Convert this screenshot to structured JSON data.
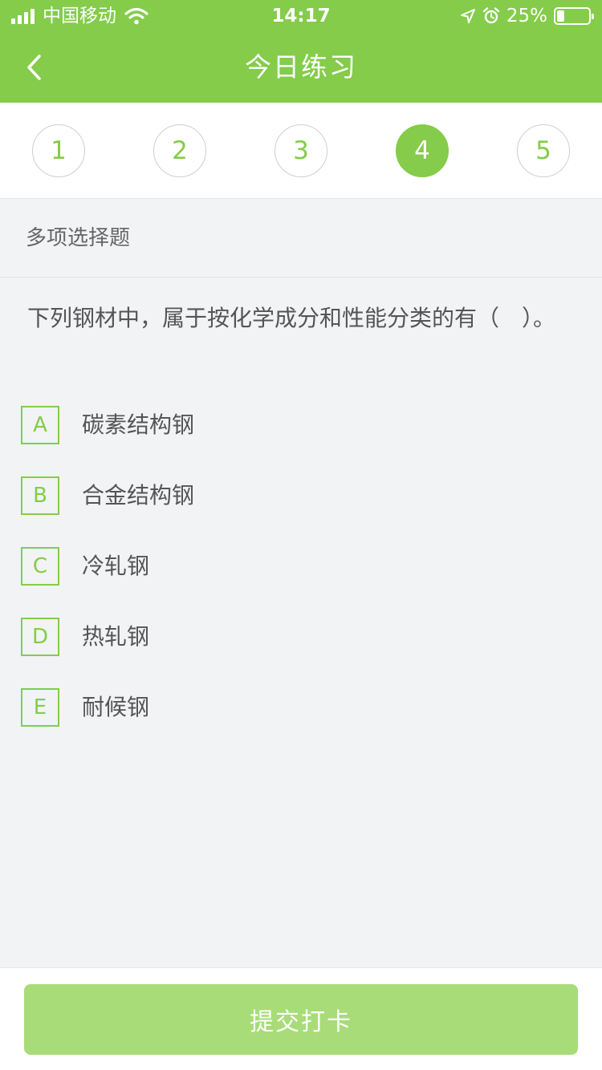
{
  "status_bar": {
    "carrier": "中国移动",
    "time": "14:17",
    "battery_percent": "25%",
    "battery_level": 0.25,
    "icons": [
      "signal-icon",
      "wifi-icon",
      "location-arrow-icon",
      "alarm-icon",
      "battery-icon"
    ]
  },
  "nav": {
    "title": "今日练习",
    "back_icon": "chevron-left-icon"
  },
  "question_numbers": {
    "items": [
      "1",
      "2",
      "3",
      "4",
      "5"
    ],
    "active": "4"
  },
  "question": {
    "type_label": "多项选择题",
    "text": "下列钢材中，属于按化学成分和性能分类的有（　）。",
    "options": [
      {
        "letter": "A",
        "text": "碳素结构钢"
      },
      {
        "letter": "B",
        "text": "合金结构钢"
      },
      {
        "letter": "C",
        "text": "冷轧钢"
      },
      {
        "letter": "D",
        "text": "热轧钢"
      },
      {
        "letter": "E",
        "text": "耐候钢"
      }
    ]
  },
  "footer": {
    "submit_label": "提交打卡"
  },
  "colors": {
    "accent": "#84cc4a",
    "submit_disabled": "#a8dc78",
    "background": "#f2f3f5"
  }
}
